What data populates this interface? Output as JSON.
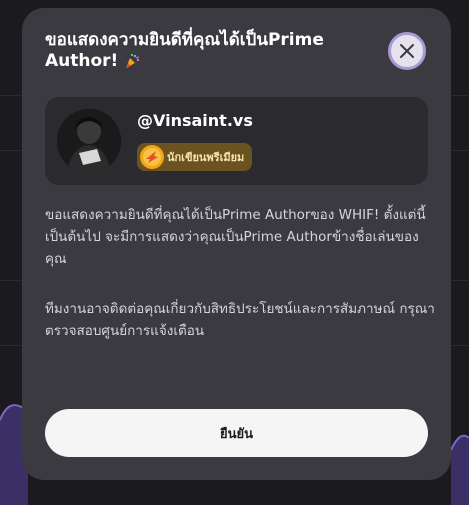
{
  "modal": {
    "title": "ขอแสดงความยินดีที่คุณได้เป็นPrime Author!",
    "title_icon": "party-popper-icon",
    "close_icon": "close-icon"
  },
  "profile": {
    "username": "@Vinsaint.vs",
    "badge_label": "นักเขียนพรีเมียม",
    "badge_icon": "premium-medal-icon"
  },
  "body": {
    "paragraph1": "ขอแสดงความยินดีที่คุณได้เป็นPrime Authorของ WHIF! ตั้งแต่นี้เป็นต้นไป จะมีการแสดงว่าคุณเป็นPrime Authorข้างชื่อเล่นของคุณ",
    "paragraph2": "ทีมงานอาจติดต่อคุณเกี่ยวกับสิทธิประโยชน์และการสัมภาษณ์ กรุณาตรวจสอบศูนย์การแจ้งเตือน"
  },
  "actions": {
    "confirm_label": "ยืนยัน"
  },
  "colors": {
    "modal_bg": "#3a3a40",
    "card_bg": "#2a2a2f",
    "close_ring": "#a899d6",
    "badge_bg": "#6a5320",
    "badge_gold": "#f2a516"
  }
}
